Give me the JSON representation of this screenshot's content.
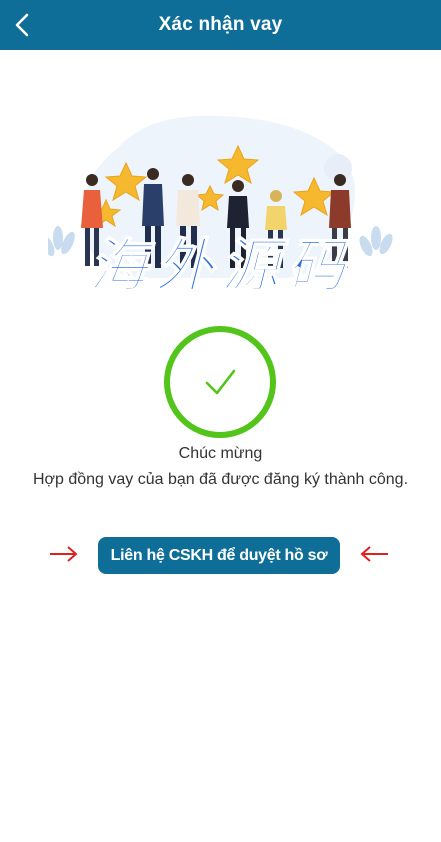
{
  "header": {
    "title": "Xác nhận vay",
    "background": "#0e6e97"
  },
  "illustration": {
    "description_icon": "celebration-people-stars-illustration",
    "watermark": "海外源码"
  },
  "status": {
    "icon": "check-circle-icon",
    "accent": "#52c41a",
    "heading": "Chúc mừng",
    "message": "Hợp đồng vay của bạn đã được đăng ký thành công."
  },
  "action": {
    "contact_label": "Liên hệ CSKH để duyệt hồ sơ",
    "arrow_color": "#e02020"
  }
}
